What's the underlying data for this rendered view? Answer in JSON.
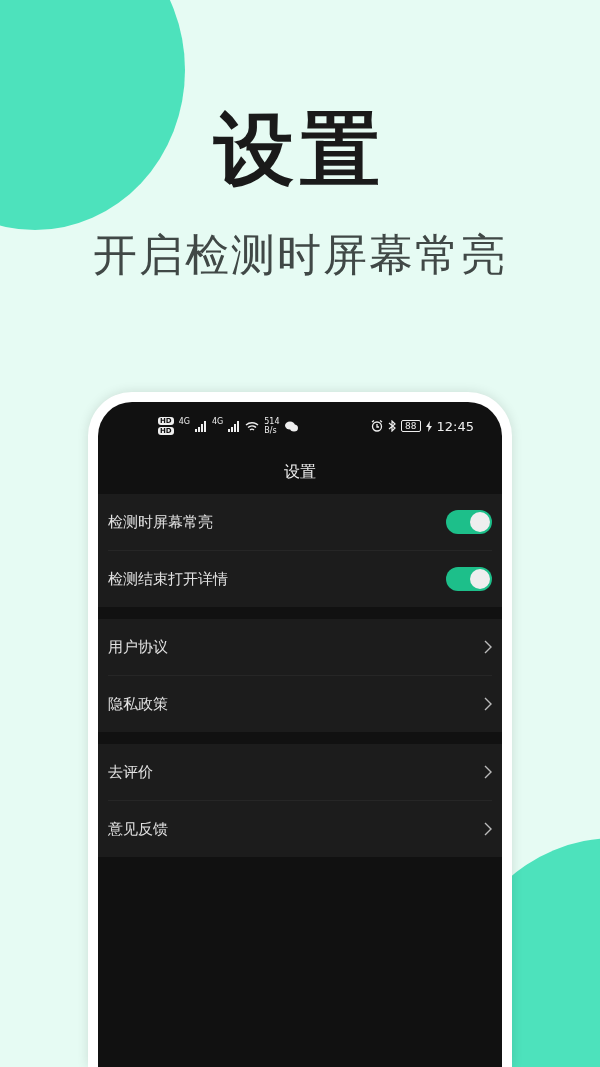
{
  "hero": {
    "title": "设置",
    "subtitle": "开启检测时屏幕常亮"
  },
  "phone": {
    "status_bar": {
      "hd_badges": [
        "HD",
        "HD"
      ],
      "network_labels": [
        "4G",
        "4G"
      ],
      "speed": "514",
      "speed_unit": "B/s",
      "battery": "88",
      "time": "12:45"
    },
    "header": {
      "title": "设置"
    },
    "groups": [
      {
        "items": [
          {
            "kind": "toggle",
            "label": "检测时屏幕常亮",
            "on": true
          },
          {
            "kind": "toggle",
            "label": "检测结束打开详情",
            "on": true
          }
        ]
      },
      {
        "items": [
          {
            "kind": "link",
            "label": "用户协议"
          },
          {
            "kind": "link",
            "label": "隐私政策"
          }
        ]
      },
      {
        "items": [
          {
            "kind": "link",
            "label": "去评价"
          },
          {
            "kind": "link",
            "label": "意见反馈"
          }
        ]
      }
    ]
  }
}
